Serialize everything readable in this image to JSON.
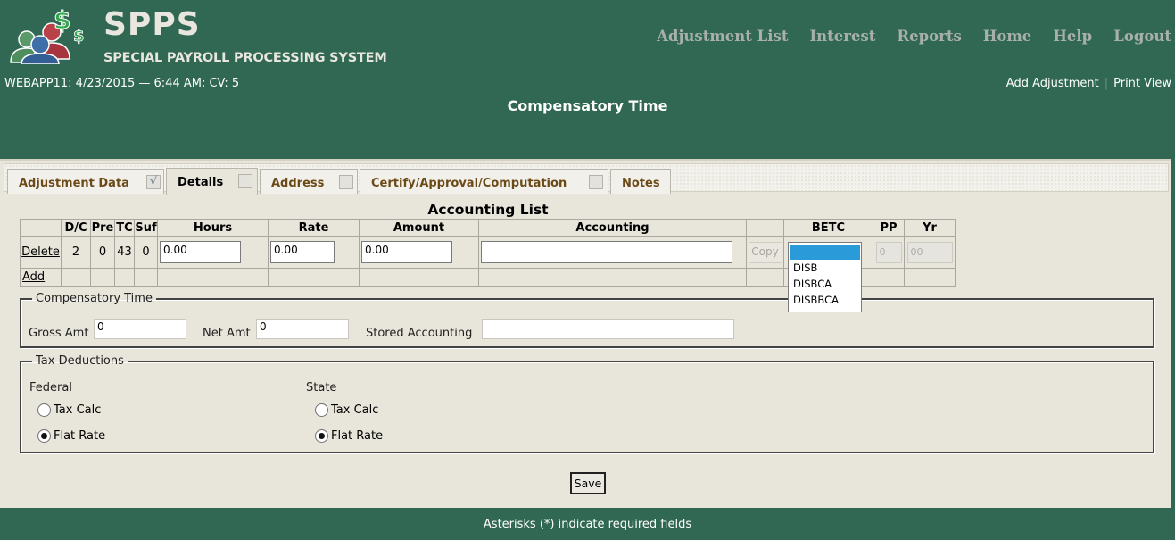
{
  "app": {
    "logo_title": "SPPS",
    "logo_subtitle": "SPECIAL PAYROLL PROCESSING SYSTEM",
    "logo_icon": "people-dollar-icon"
  },
  "nav": {
    "items": [
      {
        "label": "Adjustment List"
      },
      {
        "label": "Interest"
      },
      {
        "label": "Reports"
      },
      {
        "label": "Home"
      },
      {
        "label": "Help"
      },
      {
        "label": "Logout"
      }
    ]
  },
  "status_line": "WEBAPP11: 4/23/2015 — 6:44 AM; CV: 5",
  "sublinks": {
    "add_adjustment": "Add Adjustment",
    "separator": "|",
    "print_view": "Print View"
  },
  "page_title": "Compensatory Time",
  "tabs": [
    {
      "label": "Adjustment Data",
      "checked": true,
      "check_glyph": "√"
    },
    {
      "label": "Details",
      "checked": false,
      "active": true
    },
    {
      "label": "Address",
      "checked": false
    },
    {
      "label": "Certify/Approval/Computation",
      "checked": false
    },
    {
      "label": "Notes"
    }
  ],
  "accounting_list": {
    "title": "Accounting List",
    "columns": [
      "",
      "D/C",
      "Pre",
      "TC",
      "Suf",
      "Hours",
      "Rate",
      "Amount",
      "Accounting",
      "",
      "BETC",
      "PP",
      "Yr"
    ],
    "rows": [
      {
        "action": "Delete",
        "dc": "2",
        "pre": "0",
        "tc": "43",
        "suf": "0",
        "hours": "0.00",
        "rate": "0.00",
        "amount": "0.00",
        "accounting": "",
        "copy_label": "Copy",
        "betc": "",
        "pp": "0",
        "yr": "00"
      }
    ],
    "add_label": "Add",
    "betc_options": [
      "",
      "DISB",
      "DISBCA",
      "DISBBCA"
    ],
    "betc_highlighted": ""
  },
  "compensatory_time": {
    "legend": "Compensatory Time",
    "gross_amt_label": "Gross Amt",
    "gross_amt": "0",
    "net_amt_label": "Net Amt",
    "net_amt": "0",
    "stored_accounting_label": "Stored Accounting",
    "stored_accounting": ""
  },
  "tax_deductions": {
    "legend": "Tax Deductions",
    "federal": {
      "label": "Federal",
      "options": [
        {
          "label": "Tax Calc",
          "checked": false
        },
        {
          "label": "Flat Rate",
          "checked": true
        }
      ]
    },
    "state": {
      "label": "State",
      "options": [
        {
          "label": "Tax Calc",
          "checked": false
        },
        {
          "label": "Flat Rate",
          "checked": true
        }
      ]
    }
  },
  "save_label": "Save",
  "footer_text": "Asterisks (*) indicate required fields",
  "colors": {
    "header_bg": "#306853",
    "content_bg": "#e8e5da",
    "tab_text": "#6b4a18",
    "nav_text": "#a9b0ab",
    "dropdown_highlight": "#2a9bd8"
  }
}
